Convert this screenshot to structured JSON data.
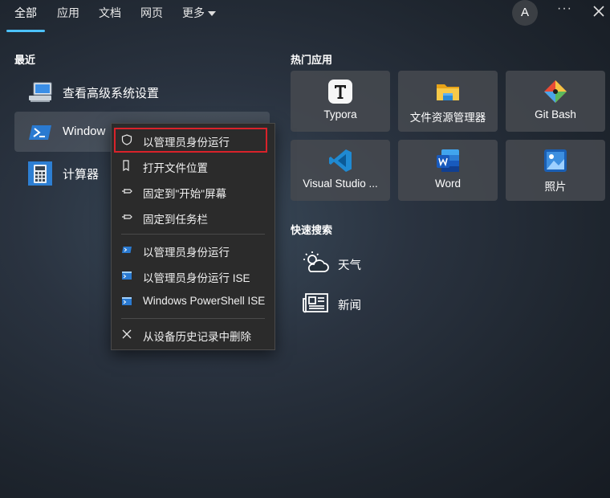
{
  "tabs": [
    {
      "label": "全部",
      "active": true
    },
    {
      "label": "应用"
    },
    {
      "label": "文档"
    },
    {
      "label": "网页"
    },
    {
      "label": "更多"
    }
  ],
  "header": {
    "avatar_letter": "A",
    "more_label": "···"
  },
  "recent": {
    "title": "最近",
    "items": [
      {
        "label": "查看高级系统设置",
        "icon": "system-settings-icon"
      },
      {
        "label": "Window",
        "icon": "powershell-icon"
      },
      {
        "label": "计算器",
        "icon": "calculator-icon"
      }
    ]
  },
  "hot_apps": {
    "title": "热门应用",
    "items": [
      {
        "label": "Typora",
        "icon": "typora-icon"
      },
      {
        "label": "文件资源管理器",
        "icon": "file-explorer-icon"
      },
      {
        "label": "Git Bash",
        "icon": "git-bash-icon"
      },
      {
        "label": "Visual Studio ...",
        "icon": "vscode-icon"
      },
      {
        "label": "Word",
        "icon": "word-icon"
      },
      {
        "label": "照片",
        "icon": "photos-icon"
      }
    ]
  },
  "quick_search": {
    "title": "快速搜索",
    "items": [
      {
        "label": "天气",
        "icon": "weather-icon"
      },
      {
        "label": "新闻",
        "icon": "news-icon"
      }
    ]
  },
  "context_menu": {
    "items": [
      {
        "label": "以管理员身份运行",
        "icon": "shield-icon",
        "highlighted": true
      },
      {
        "label": "打开文件位置",
        "icon": "file-location-icon"
      },
      {
        "label": "固定到\"开始\"屏幕",
        "icon": "pin-icon"
      },
      {
        "label": "固定到任务栏",
        "icon": "pin-icon"
      },
      {
        "label": "以管理员身份运行",
        "icon": "powershell-icon"
      },
      {
        "label": "以管理员身份运行 ISE",
        "icon": "powershell-ise-icon"
      },
      {
        "label": "Windows PowerShell ISE",
        "icon": "powershell-ise-icon"
      },
      {
        "label": "从设备历史记录中删除",
        "icon": "close-icon"
      }
    ]
  },
  "colors": {
    "accent": "#4cc2ff",
    "highlight_border": "#d9222a"
  }
}
